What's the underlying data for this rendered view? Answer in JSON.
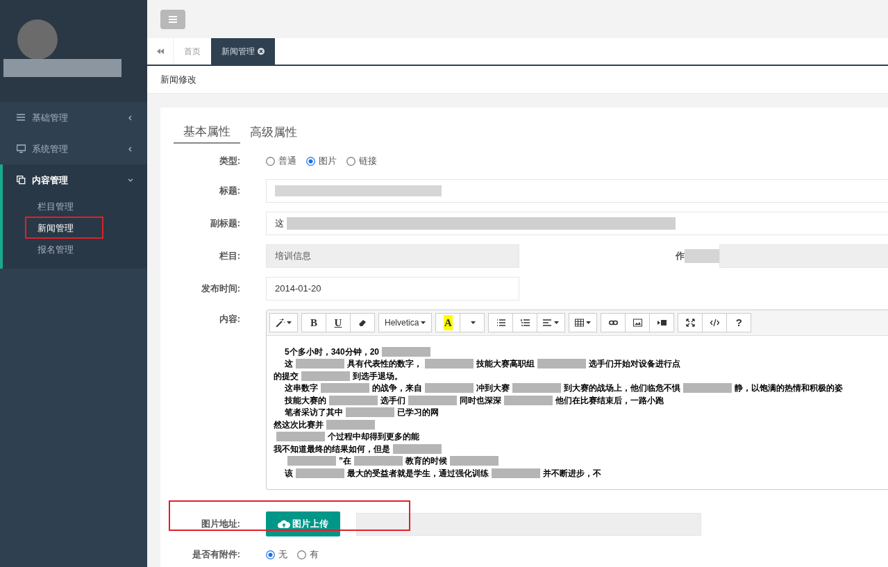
{
  "sidebar": {
    "menu": [
      {
        "label": "基础管理",
        "expanded": false
      },
      {
        "label": "系统管理",
        "expanded": false
      },
      {
        "label": "内容管理",
        "expanded": true,
        "children": [
          {
            "label": "栏目管理",
            "selected": false,
            "annotated": false
          },
          {
            "label": "新闻管理",
            "selected": true,
            "annotated": true
          },
          {
            "label": "报名管理",
            "selected": false,
            "annotated": false
          }
        ]
      }
    ]
  },
  "tabs": [
    {
      "label": "首页",
      "selected": false,
      "closable": false
    },
    {
      "label": "新闻管理",
      "selected": true,
      "closable": true
    }
  ],
  "breadcrumb": "新闻修改",
  "form_tabs": [
    {
      "label": "基本属性",
      "selected": true
    },
    {
      "label": "高级属性",
      "selected": false
    }
  ],
  "type_row": {
    "label": "类型:",
    "options": [
      {
        "label": "普通",
        "selected": false
      },
      {
        "label": "图片",
        "selected": true
      },
      {
        "label": "链接",
        "selected": false
      }
    ]
  },
  "title_row": {
    "label": "标题:"
  },
  "subtitle_row": {
    "label": "副标题:",
    "value": "这"
  },
  "column_row": {
    "label": "栏目:",
    "value": "培训信息",
    "author_label": "作"
  },
  "date_row": {
    "label": "发布时间:",
    "value": "2014-01-20"
  },
  "content_row": {
    "label": "内容:",
    "toolbar": [
      [
        {
          "kind": "magic"
        }
      ],
      [
        {
          "kind": "bold",
          "text": "B"
        },
        {
          "kind": "underline",
          "text": "U"
        },
        {
          "kind": "eraser"
        }
      ],
      [
        {
          "kind": "font",
          "text": "Helvetica"
        }
      ],
      [
        {
          "kind": "color",
          "text": "A"
        },
        {
          "kind": "caret"
        }
      ],
      [
        {
          "kind": "ul"
        },
        {
          "kind": "ol"
        },
        {
          "kind": "align"
        }
      ],
      [
        {
          "kind": "table"
        }
      ],
      [
        {
          "kind": "link"
        },
        {
          "kind": "picture"
        },
        {
          "kind": "video"
        }
      ],
      [
        {
          "kind": "fullscreen"
        },
        {
          "kind": "code"
        },
        {
          "kind": "help",
          "text": "?"
        }
      ]
    ],
    "lines": [
      {
        "indent": true,
        "parts": [
          {
            "kind": "text",
            "text": "5个多小时，340分钟，20"
          },
          {
            "kind": "redacted"
          }
        ]
      },
      {
        "indent": true,
        "parts": [
          {
            "kind": "text",
            "text": "这"
          },
          {
            "kind": "redacted"
          },
          {
            "kind": "text",
            "text": "具有代表性的数字，"
          },
          {
            "kind": "redacted"
          },
          {
            "kind": "text",
            "text": "技能大赛高职组"
          },
          {
            "kind": "redacted"
          },
          {
            "kind": "text",
            "text": "选手们开始对设备进行点"
          }
        ]
      },
      {
        "indent": false,
        "parts": [
          {
            "kind": "text",
            "text": "的提交"
          },
          {
            "kind": "redacted"
          },
          {
            "kind": "text",
            "text": "到选手退场。"
          }
        ]
      },
      {
        "indent": true,
        "parts": [
          {
            "kind": "text",
            "text": "这串数字"
          },
          {
            "kind": "redacted"
          },
          {
            "kind": "text",
            "text": "的战争，来自"
          },
          {
            "kind": "redacted"
          },
          {
            "kind": "text",
            "text": "冲到大赛"
          },
          {
            "kind": "redacted"
          },
          {
            "kind": "text",
            "text": "到大赛的战场上，他们临危不惧"
          },
          {
            "kind": "redacted"
          },
          {
            "kind": "text",
            "text": "静，以饱满的热情和积极的姿"
          }
        ]
      },
      {
        "indent": true,
        "parts": [
          {
            "kind": "text",
            "text": "技能大赛的"
          },
          {
            "kind": "redacted"
          },
          {
            "kind": "text",
            "text": "选手们"
          },
          {
            "kind": "redacted"
          },
          {
            "kind": "text",
            "text": "同时也深深"
          },
          {
            "kind": "redacted"
          },
          {
            "kind": "text",
            "text": "他们在比赛结束后，一路小跑"
          }
        ]
      },
      {
        "indent": true,
        "parts": [
          {
            "kind": "text",
            "text": "笔者采访了其中"
          },
          {
            "kind": "redacted"
          },
          {
            "kind": "text",
            "text": "已学习的网"
          }
        ]
      },
      {
        "indent": false,
        "parts": [
          {
            "kind": "text",
            "text": "然这次比赛并"
          },
          {
            "kind": "redacted"
          }
        ]
      },
      {
        "indent": false,
        "parts": [
          {
            "kind": "redacted"
          },
          {
            "kind": "text",
            "text": "个过程中却得到更多的能"
          }
        ]
      },
      {
        "indent": false,
        "parts": [
          {
            "kind": "text",
            "text": "我不知道最终的结果如何，但是"
          },
          {
            "kind": "redacted"
          }
        ]
      },
      {
        "indent": true,
        "parts": [
          {
            "kind": "redacted"
          },
          {
            "kind": "text",
            "text": "”在"
          },
          {
            "kind": "redacted"
          },
          {
            "kind": "text",
            "text": "教育的时候"
          },
          {
            "kind": "redacted"
          }
        ]
      },
      {
        "indent": true,
        "parts": [
          {
            "kind": "text",
            "text": "该"
          },
          {
            "kind": "redacted"
          },
          {
            "kind": "text",
            "text": "最大的受益者就是学生，通过强化训练"
          },
          {
            "kind": "redacted"
          },
          {
            "kind": "text",
            "text": "并不断进步，不"
          }
        ]
      }
    ]
  },
  "image_row": {
    "label": "图片地址:",
    "button": "图片上传",
    "annotated": true
  },
  "attachment_row": {
    "label": "是否有附件:",
    "options": [
      {
        "label": "无",
        "selected": true
      },
      {
        "label": "有",
        "selected": false
      }
    ]
  }
}
